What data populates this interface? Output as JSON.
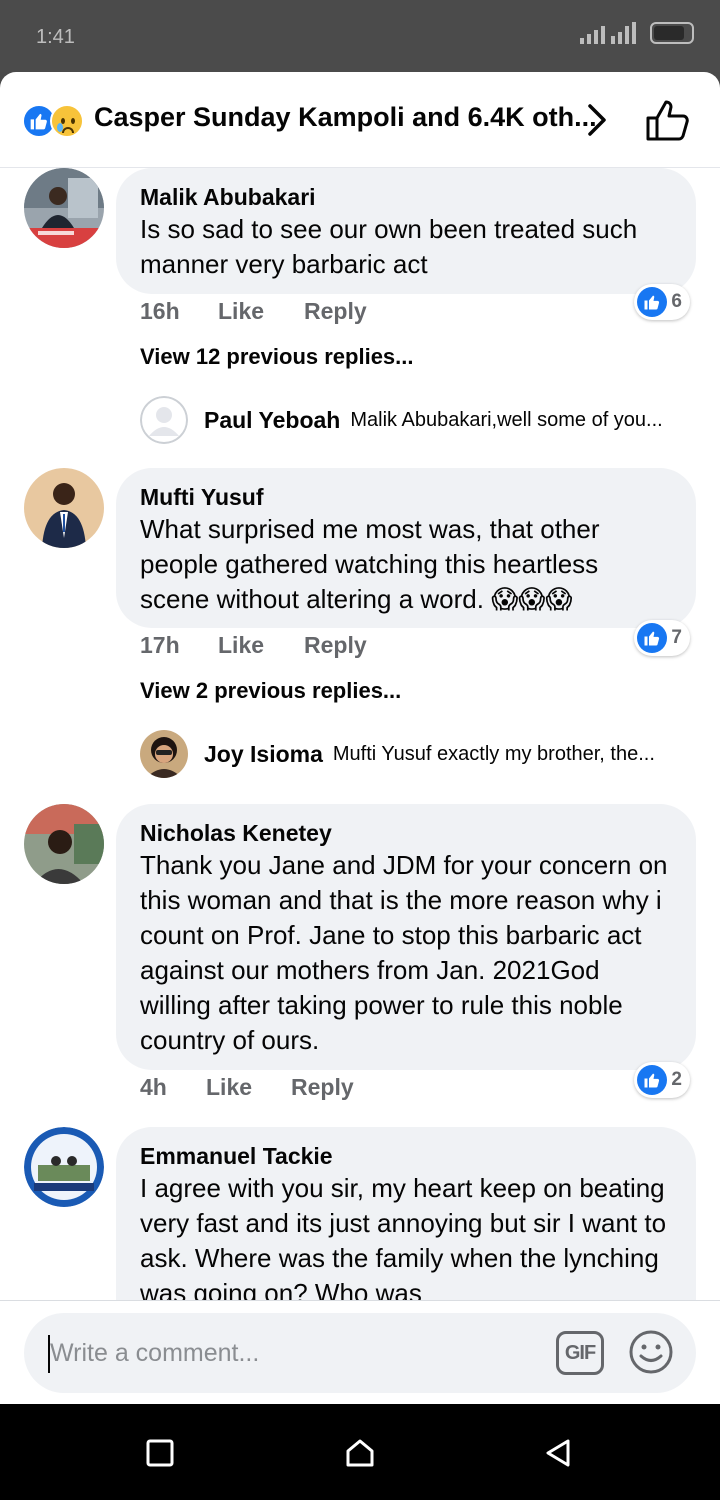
{
  "status_bar": {
    "time": "1:41"
  },
  "header": {
    "title": "Casper Sunday Kampoli and 6.4K oth..."
  },
  "comments": [
    {
      "author": "Malik Abubakari",
      "text": "Is so sad to see our own been treated such manner very barbaric act",
      "time": "16h",
      "like_label": "Like",
      "reply_label": "Reply",
      "like_count": "6",
      "view_previous": "View 12 previous replies...",
      "reply": {
        "author": "Paul Yeboah",
        "text": "Malik Abubakari,well some of you..."
      }
    },
    {
      "author": "Mufti Yusuf",
      "text": "What surprised me most was, that other people gathered watching this heartless scene without altering a word. 😱😱😱",
      "time": "17h",
      "like_label": "Like",
      "reply_label": "Reply",
      "like_count": "7",
      "view_previous": "View 2 previous replies...",
      "reply": {
        "author": "Joy Isioma",
        "text": "Mufti Yusuf exactly my brother, the..."
      }
    },
    {
      "author": "Nicholas Kenetey",
      "text": "Thank you Jane and JDM for your concern on this woman and that is the more reason why i count on Prof. Jane to stop this barbaric act against our mothers from Jan. 2021God willing after taking power to rule this noble country of ours.",
      "time": "4h",
      "like_label": "Like",
      "reply_label": "Reply",
      "like_count": "2"
    },
    {
      "author": "Emmanuel Tackie",
      "text": "I agree with you sir, my heart keep on beating very fast and its just annoying but sir I want to ask. Where was the family when the lynching was going on? Who was"
    }
  ],
  "composer": {
    "placeholder": "Write a comment...",
    "gif_label": "GIF"
  },
  "colors": {
    "accent": "#1877f2",
    "bubble": "#f0f2f5",
    "secondary_text": "#65676b"
  },
  "icons": [
    "like-reaction-icon",
    "sad-reaction-icon",
    "chevron-right-icon",
    "thumbs-up-icon",
    "gif-icon",
    "emoji-icon",
    "square-nav-icon",
    "home-nav-icon",
    "back-nav-icon"
  ]
}
